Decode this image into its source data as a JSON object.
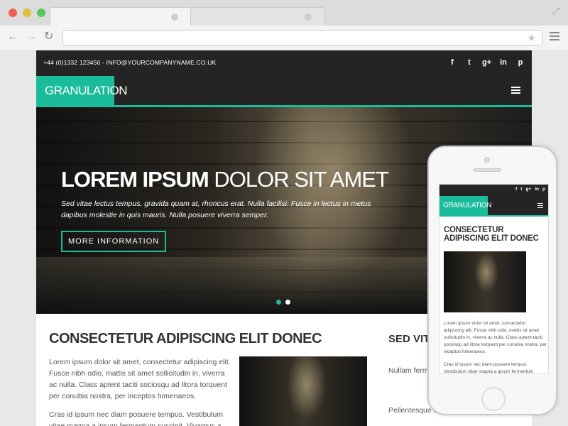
{
  "site": {
    "contact": "+44 (0)1332 123456 - INFO@YOURCOMPANYNAME.CO.UK",
    "social": [
      "f",
      "t",
      "g+",
      "in",
      "p"
    ],
    "logo": "GRANULATION",
    "hero": {
      "title_bold": "LOREM IPSUM",
      "title_rest": " DOLOR SIT AMET",
      "text": "Sed vitae lectus tempus, gravida quam at, rhoncus erat. Nulla facilisi. Fusce in lectus in metus dapibus molestie in quis mauris. Nulla posuere viverra semper.",
      "button": "MORE INFORMATION"
    },
    "section1": {
      "heading": "CONSECTETUR ADIPISCING ELIT DONEC",
      "p1": "Lorem ipsum dolor sit amet, consectetur adipiscing elit. Fusce nibh odio, mattis sit amet sollicitudin in, viverra ac nulla. Class aptent taciti sociosqu ad litora torquent per conubia nostra, per inceptos himenaeos.",
      "p2": "Cras id ipsum nec diam posuere tempus. Vestibulum vitae magna a ipsum fermentum suscipit. Vivamus a"
    },
    "section2": {
      "heading": "SED VITAE TINCIDUNT",
      "p1": "Nullam ferm gravida. Se tincidunt ele",
      "p2": "Pellentesque s sagittis. Quisque"
    }
  },
  "phone": {
    "social": [
      "f",
      "t",
      "g+",
      "in",
      "p"
    ],
    "logo": "GRANULATION",
    "heading": "CONSECTETUR ADIPISCING ELIT DONEC",
    "p1": "Lorem ipsum dolor sit amet, consectetur adipiscing elit. Fusce nibh odio, mattis sit amet sollicitudin in, viverra ac nulla. Class aptent taciti sociosqu ad litora torquent per conubia nostra, per inceptos himenaeos.",
    "p2": "Cras id ipsum nec diam posuere tempus. Vestibulum vitae magna a ipsum fermentum"
  },
  "colors": {
    "accent": "#1abc9c",
    "dark": "#242424"
  },
  "icons": {
    "back": "back-arrow-icon",
    "forward": "forward-arrow-icon",
    "reload": "reload-icon",
    "bookmark": "star-icon",
    "menu": "hamburger-icon"
  }
}
